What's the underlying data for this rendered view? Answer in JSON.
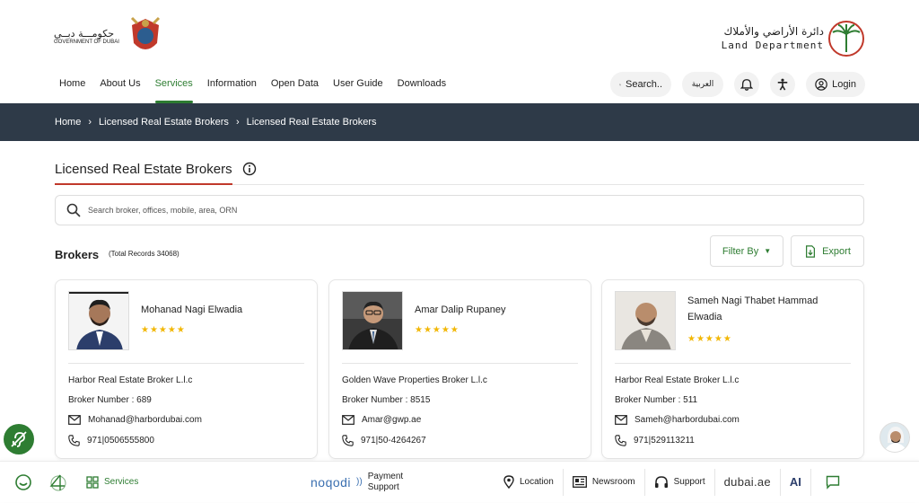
{
  "header": {
    "gov_logo_ar": "حكومـــة دبــي",
    "gov_logo_en": "GOVERNMENT OF DUBAI",
    "ld_logo_ar": "دائرة الأراضي والأملاك",
    "ld_logo_en": "Land Department"
  },
  "nav": [
    {
      "label": "Home"
    },
    {
      "label": "About Us"
    },
    {
      "label": "Services"
    },
    {
      "label": "Information"
    },
    {
      "label": "Open Data"
    },
    {
      "label": "User Guide"
    },
    {
      "label": "Downloads"
    }
  ],
  "actions": {
    "search_label": "Search..",
    "lang_label": "العربية",
    "login_label": "Login"
  },
  "breadcrumb": [
    "Home",
    "Licensed Real Estate Brokers",
    "Licensed Real Estate Brokers"
  ],
  "page": {
    "title": "Licensed Real Estate Brokers",
    "search_placeholder": "Search broker, offices, mobile, area, ORN",
    "brokers_title": "Brokers",
    "total_records": "(Total Records 34068)",
    "filter_label": "Filter By",
    "export_label": "Export"
  },
  "brokers": [
    {
      "name": "Mohanad Nagi Elwadia",
      "stars": "★★★★★",
      "company": "Harbor Real Estate Broker L.l.c",
      "number": "Broker Number : 689",
      "email": "Mohanad@harbordubai.com",
      "phone": "971|0506555800"
    },
    {
      "name": "Amar Dalip Rupaney",
      "stars": "★★★★★",
      "company": "Golden Wave Properties Broker L.l.c",
      "number": "Broker Number : 8515",
      "email": "Amar@gwp.ae",
      "phone": "971|50-4264267"
    },
    {
      "name": "Sameh Nagi Thabet Hammad Elwadia",
      "stars": "★★★★★",
      "company": "Harbor Real Estate Broker L.l.c",
      "number": "Broker Number : 511",
      "email": "Sameh@harbordubai.com",
      "phone": "971|529113211"
    }
  ],
  "bottom_bar": {
    "services": "Services",
    "noqodi": "noqodi",
    "payment_support_1": "Payment",
    "payment_support_2": "Support",
    "location": "Location",
    "newsroom": "Newsroom",
    "support": "Support",
    "dubai_ae": "dubai.ae",
    "ai": "AI"
  },
  "colors": {
    "accent_green": "#2e7d32",
    "breadcrumb_bg": "#2e3a48",
    "title_underline": "#c0392b",
    "star": "#f2b705"
  }
}
